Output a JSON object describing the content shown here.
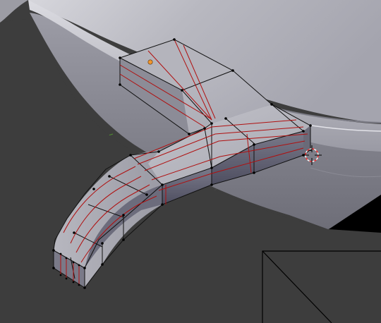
{
  "viewport": {
    "background_color": "#3d3d3d",
    "grid_line_color": "#4a4a4a",
    "x_axis_color": "#9a3434",
    "y_axis_color": "#4f8f2e"
  },
  "scene": {
    "surface_fill_light": "#c2c2c8",
    "surface_fill_dark": "#7f7f88",
    "mesh_face_fill": "#8e8e97",
    "mesh_face_light": "#b9b9c0",
    "mesh_face_dark": "#5c5c6c",
    "wire_color": "#111111",
    "seam_color": "#b01010",
    "vertex_color": "#000000",
    "origin_color": "#f0962c",
    "cursor_ring_colors": [
      "#ff2a2a",
      "#ffffff"
    ],
    "cursor_cross_color": "#000000",
    "icons": [
      "origin-dot-icon",
      "3d-cursor-icon"
    ]
  }
}
